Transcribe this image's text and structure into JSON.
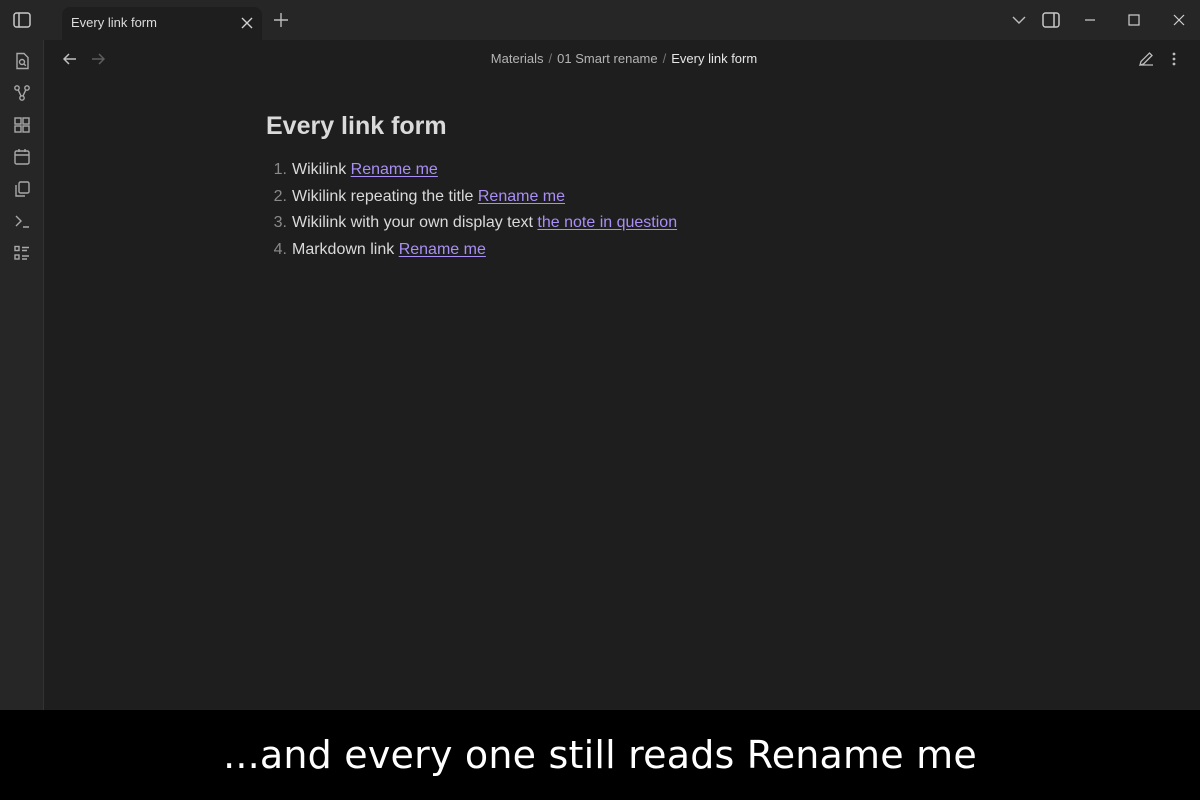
{
  "tab": {
    "title": "Every link form"
  },
  "breadcrumb": {
    "items": [
      "Materials",
      "01 Smart rename"
    ],
    "separator": "/",
    "current": "Every link form"
  },
  "note": {
    "title": "Every link form",
    "items": [
      {
        "num": "1.",
        "text": "Wikilink ",
        "link": "Rename me"
      },
      {
        "num": "2.",
        "text": "Wikilink repeating the title ",
        "link": "Rename me"
      },
      {
        "num": "3.",
        "text": "Wikilink with your own display text ",
        "link": "the note in question"
      },
      {
        "num": "4.",
        "text": "Markdown link ",
        "link": "Rename me"
      }
    ]
  },
  "caption": "...and every one still reads Rename me",
  "colors": {
    "accent_link": "#a98ff5",
    "background": "#1e1e1e",
    "caption_bar": "#000000"
  },
  "icons": {
    "titlebar": [
      "sidebar-toggle-icon",
      "plus-icon",
      "chevron-down-icon",
      "right-sidebar-icon",
      "minimize-icon",
      "maximize-icon",
      "close-icon"
    ],
    "ribbon": [
      "file-search-icon",
      "graph-icon",
      "canvas-icon",
      "calendar-icon",
      "copy-icon",
      "terminal-icon",
      "list-icon"
    ],
    "header": [
      "arrow-left-icon",
      "arrow-right-icon",
      "edit-icon",
      "more-icon"
    ]
  }
}
